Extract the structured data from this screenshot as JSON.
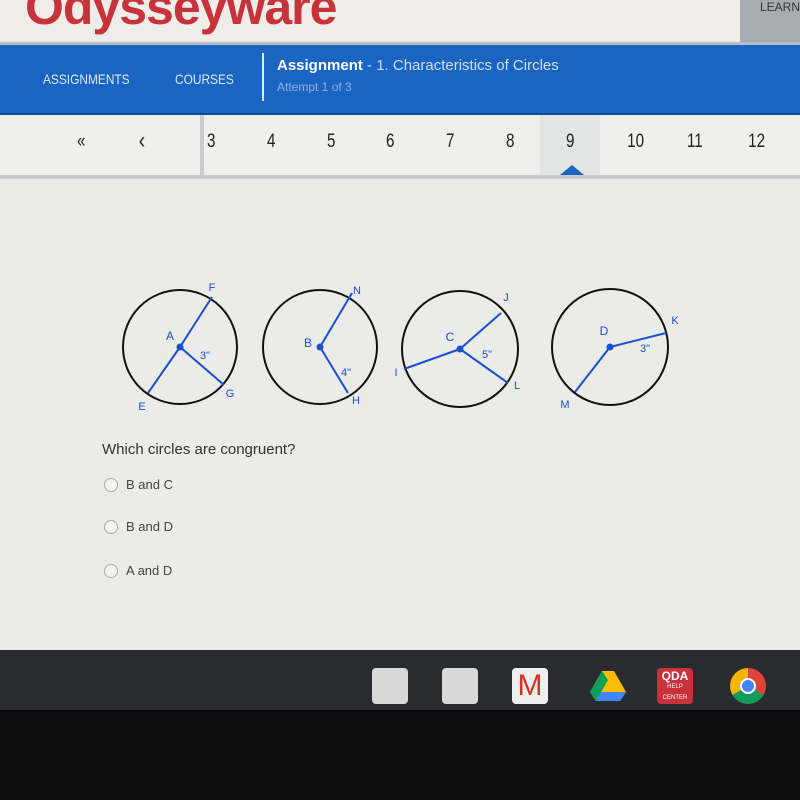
{
  "header": {
    "logo": "Odysseyware",
    "top_right": "LEARN"
  },
  "nav": {
    "assignments": "ASSIGNMENTS",
    "courses": "COURSES",
    "title_bold": "Assignment",
    "title_rest": " - 1. Characteristics of Circles",
    "attempt": "Attempt 1 of 3"
  },
  "pager": {
    "first": "«",
    "prev": "‹",
    "pages": [
      "3",
      "4",
      "5",
      "6",
      "7",
      "8",
      "9",
      "10",
      "11",
      "12"
    ],
    "current": "9"
  },
  "figure": {
    "circles": [
      {
        "center": "A",
        "points": [
          "F",
          "E",
          "G"
        ],
        "measure": "3\""
      },
      {
        "center": "B",
        "points": [
          "N",
          "H"
        ],
        "measure": "4\""
      },
      {
        "center": "C",
        "points": [
          "J",
          "I",
          "L"
        ],
        "measure": "5\""
      },
      {
        "center": "D",
        "points": [
          "K",
          "M"
        ],
        "measure": "3\""
      }
    ]
  },
  "question": {
    "text": "Which circles are congruent?",
    "options": [
      "B and C",
      "B and D",
      "A and D"
    ]
  },
  "shelf": {
    "apps": [
      "slides-icon",
      "slides-icon",
      "gmail-icon",
      "drive-icon",
      "qda-help-center-icon",
      "chrome-icon"
    ],
    "qda_label": "QDA",
    "qda_sub": "HELP CENTER"
  },
  "colors": {
    "brand": "#c8323a",
    "nav": "#1a64c2",
    "figure_blue": "#1a4fd0"
  }
}
